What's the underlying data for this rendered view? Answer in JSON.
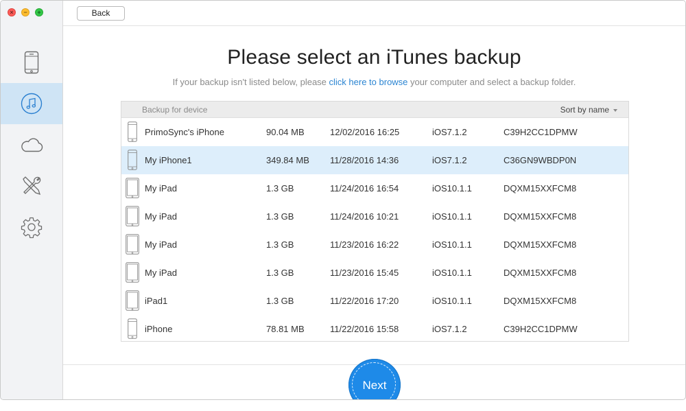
{
  "window": {
    "controls": [
      "close",
      "minimize",
      "zoom"
    ]
  },
  "sidebar": {
    "items": [
      {
        "id": "device",
        "icon": "iphone-icon",
        "active": false
      },
      {
        "id": "itunes",
        "icon": "music-note-icon",
        "active": true
      },
      {
        "id": "icloud",
        "icon": "cloud-icon",
        "active": false
      },
      {
        "id": "tools",
        "icon": "tools-icon",
        "active": false
      },
      {
        "id": "settings",
        "icon": "gear-icon",
        "active": false
      }
    ]
  },
  "toolbar": {
    "back_label": "Back"
  },
  "main": {
    "title": "Please select an iTunes backup",
    "subtitle_before": "If your backup isn't listed below, please ",
    "subtitle_link": "click here to browse",
    "subtitle_after": " your computer and select a backup folder."
  },
  "table": {
    "header_label": "Backup for device",
    "sort_label": "Sort by name",
    "rows": [
      {
        "name": "PrimoSync's iPhone",
        "size": "90.04 MB",
        "date": "12/02/2016 16:25",
        "ios": "iOS7.1.2",
        "id": "C39H2CC1DPMW",
        "device": "iphone",
        "selected": false
      },
      {
        "name": "My iPhone1",
        "size": "349.84 MB",
        "date": "11/28/2016 14:36",
        "ios": "iOS7.1.2",
        "id": "C36GN9WBDP0N",
        "device": "iphone",
        "selected": true
      },
      {
        "name": "My iPad",
        "size": "1.3 GB",
        "date": "11/24/2016 16:54",
        "ios": "iOS10.1.1",
        "id": "DQXM15XXFCM8",
        "device": "ipad",
        "selected": false
      },
      {
        "name": "My iPad",
        "size": "1.3 GB",
        "date": "11/24/2016 10:21",
        "ios": "iOS10.1.1",
        "id": "DQXM15XXFCM8",
        "device": "ipad",
        "selected": false
      },
      {
        "name": "My iPad",
        "size": "1.3 GB",
        "date": "11/23/2016 16:22",
        "ios": "iOS10.1.1",
        "id": "DQXM15XXFCM8",
        "device": "ipad",
        "selected": false
      },
      {
        "name": "My iPad",
        "size": "1.3 GB",
        "date": "11/23/2016 15:45",
        "ios": "iOS10.1.1",
        "id": "DQXM15XXFCM8",
        "device": "ipad",
        "selected": false
      },
      {
        "name": "iPad1",
        "size": "1.3 GB",
        "date": "11/22/2016 17:20",
        "ios": "iOS10.1.1",
        "id": "DQXM15XXFCM8",
        "device": "ipad",
        "selected": false
      },
      {
        "name": "iPhone",
        "size": "78.81 MB",
        "date": "11/22/2016 15:58",
        "ios": "iOS7.1.2",
        "id": "C39H2CC1DPMW",
        "device": "iphone",
        "selected": false
      }
    ]
  },
  "footer": {
    "next_label": "Next"
  },
  "colors": {
    "accent": "#1e8ae8",
    "link": "#2a84d2",
    "selected_row": "#ddeefb",
    "sidebar_active": "#cfe4f5"
  }
}
